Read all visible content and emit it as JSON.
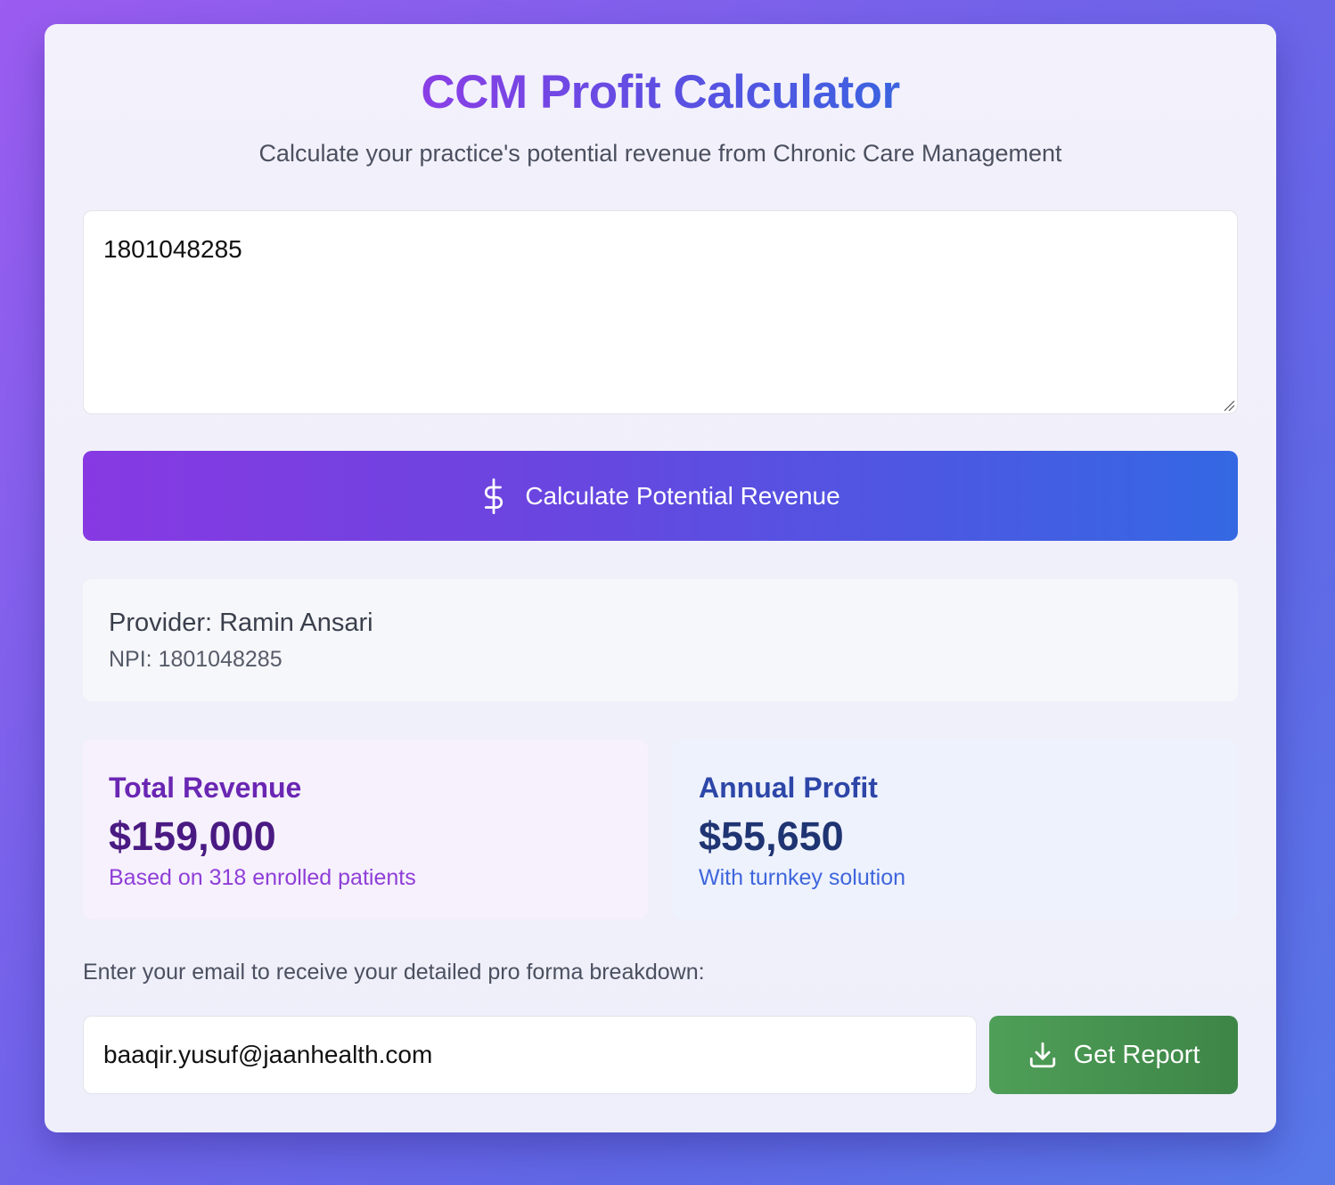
{
  "header": {
    "title": "CCM Profit Calculator",
    "subtitle": "Calculate your practice's potential revenue from Chronic Care Management"
  },
  "npi_input": {
    "value": "1801048285"
  },
  "calculate_button": {
    "label": "Calculate Potential Revenue",
    "icon": "dollar-sign-icon"
  },
  "provider": {
    "name_line": "Provider: Ramin Ansari",
    "npi_line": "NPI: 1801048285"
  },
  "results": {
    "revenue": {
      "label": "Total Revenue",
      "value": "$159,000",
      "note": "Based on 318 enrolled patients"
    },
    "profit": {
      "label": "Annual Profit",
      "value": "$55,650",
      "note": "With turnkey solution"
    }
  },
  "email": {
    "prompt": "Enter your email to receive your detailed pro forma breakdown:",
    "value": "baaqir.yusuf@jaanhealth.com"
  },
  "report_button": {
    "label": "Get Report",
    "icon": "download-icon"
  },
  "colors": {
    "accent_purple": "#8739e2",
    "accent_blue": "#3468e3",
    "report_green": "#4f9f58"
  }
}
